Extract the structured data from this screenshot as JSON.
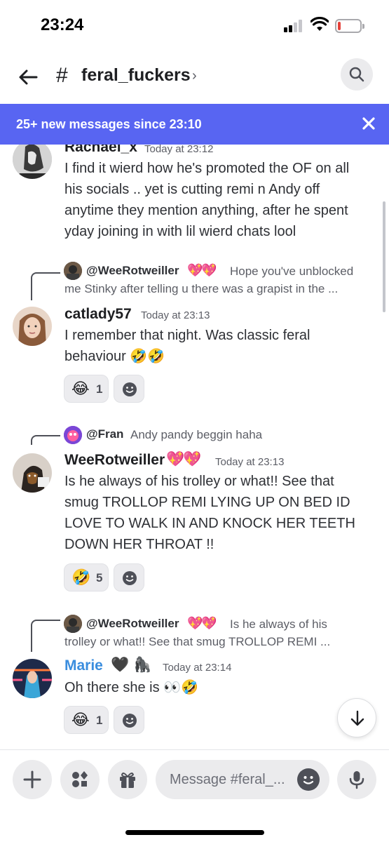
{
  "status": {
    "time": "23:24"
  },
  "header": {
    "channel": "feral_fuckers",
    "hash": "#",
    "chevron": "›"
  },
  "banner": {
    "text": "25+ new messages since 23:10"
  },
  "messages": [
    {
      "author": "Rachael_x",
      "timestamp": "Today at 23:12",
      "lines": [
        "I find it wierd how he's promoted the OF on all",
        "his socials .. yet is cutting remi n Andy off",
        "anytime they mention anything, after he spent",
        "yday joining in with lil wierd chats lool"
      ]
    },
    {
      "reply": {
        "name": "@WeeRotweiller",
        "hearts": "💖💖",
        "line1": "Hope you've unblocked",
        "line2": "me Stinky after telling u there was a grapist in the ..."
      },
      "author": "catlady57",
      "timestamp": "Today at 23:13",
      "lines": [
        "I remember that night. Was classic feral",
        "behaviour 🤣🤣"
      ],
      "reaction": {
        "emoji": "😂",
        "count": "1"
      }
    },
    {
      "reply": {
        "name": "@Fran",
        "line1": "Andy pandy beggin haha"
      },
      "author": "WeeRotweiller",
      "author_hearts": "💖💖",
      "timestamp": "Today at 23:13",
      "lines": [
        "Is he always of his trolley or what!! See that",
        "smug TROLLOP REMI LYING UP ON BED ID",
        "LOVE TO WALK IN AND KNOCK HER TEETH",
        "DOWN HER THROAT !!"
      ],
      "reaction": {
        "emoji": "🤣",
        "count": "5"
      }
    },
    {
      "reply": {
        "name": "@WeeRotweiller",
        "hearts": "💖💖",
        "line1": "Is he always of his",
        "line2": "trolley or what!! See that smug TROLLOP REMI ..."
      },
      "author": "Marie",
      "author_badges": "🖤 🦍",
      "timestamp": "Today at 23:14",
      "lines": [
        "Oh there she is 👀🤣"
      ],
      "reaction": {
        "emoji": "😂",
        "count": "1"
      }
    }
  ],
  "composer": {
    "placeholder": "Message #feral_..."
  },
  "colors": {
    "blurple": "#5865f2",
    "marie_name": "#3a8dde"
  },
  "icons": [
    "back-arrow-icon",
    "search-icon",
    "close-icon",
    "add-reaction-icon",
    "scroll-down-icon",
    "plus-icon",
    "apps-icon",
    "gift-icon",
    "emoji-icon",
    "microphone-icon"
  ]
}
